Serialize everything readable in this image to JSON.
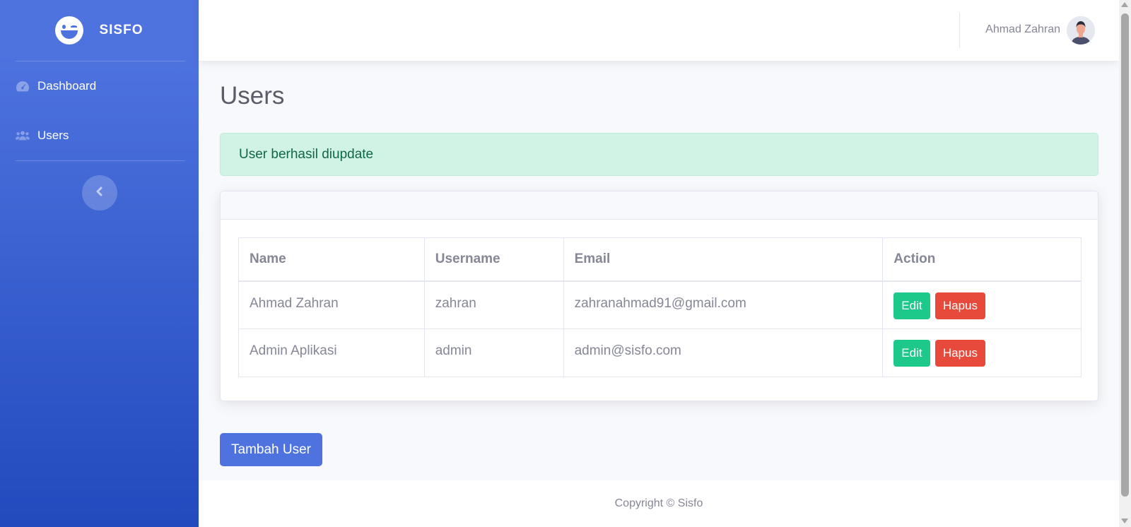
{
  "sidebar": {
    "brand": "SISFO",
    "items": [
      {
        "label": "Dashboard",
        "icon": "tachometer-icon"
      },
      {
        "label": "Users",
        "icon": "users-icon"
      }
    ],
    "toggle_icon": "chevron-left-icon"
  },
  "topbar": {
    "user_name": "Ahmad Zahran"
  },
  "main": {
    "title": "Users",
    "alert": "User berhasil diupdate",
    "table": {
      "headers": [
        "Name",
        "Username",
        "Email",
        "Action"
      ],
      "rows": [
        {
          "name": "Ahmad Zahran",
          "username": "zahran",
          "email": "zahranahmad91@gmail.com",
          "edit": "Edit",
          "delete": "Hapus"
        },
        {
          "name": "Admin Aplikasi",
          "username": "admin",
          "email": "admin@sisfo.com",
          "edit": "Edit",
          "delete": "Hapus"
        }
      ]
    },
    "add_button": "Tambah User"
  },
  "footer": {
    "copyright": "Copyright © Sisfo"
  },
  "colors": {
    "primary": "#4e73df",
    "success": "#1cc88a",
    "danger": "#e74a3b",
    "alert_bg": "#d1f3e6"
  }
}
